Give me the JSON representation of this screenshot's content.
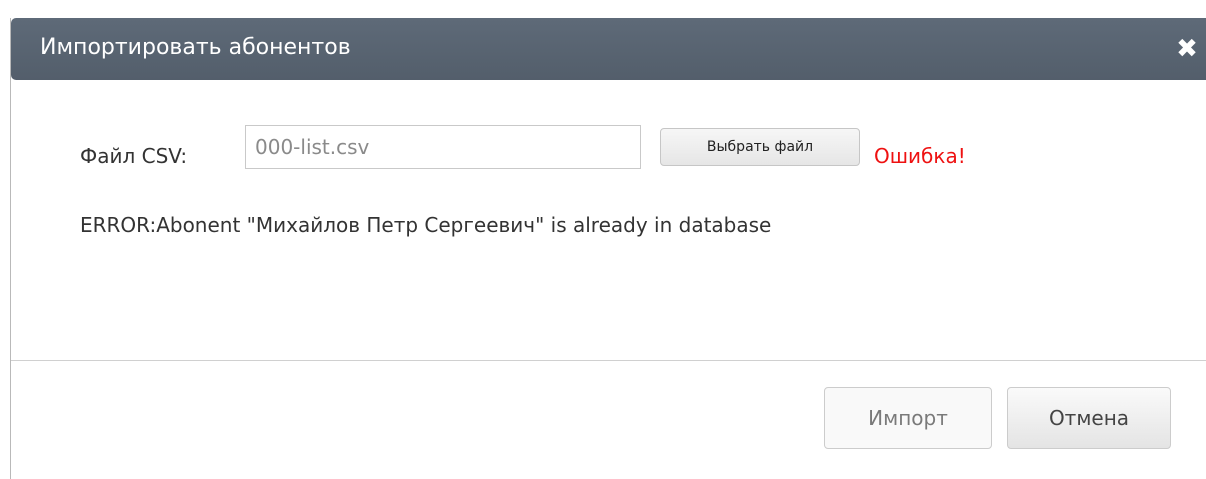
{
  "dialog": {
    "title": "Импортировать абонентов",
    "close_glyph": "✖",
    "close_icon": "close-icon",
    "colors": {
      "titlebar": "#59636f",
      "error": "#ee1111"
    }
  },
  "form": {
    "csv_label": "Файл CSV:",
    "csv_value": "000-list.csv",
    "choose_file_label": "Выбрать файл",
    "status": "Ошибка!",
    "error_message": "ERROR:Abonent \"Михайлов Петр Сергеевич\" is already in database"
  },
  "footer": {
    "import_label": "Импорт",
    "cancel_label": "Отмена"
  }
}
